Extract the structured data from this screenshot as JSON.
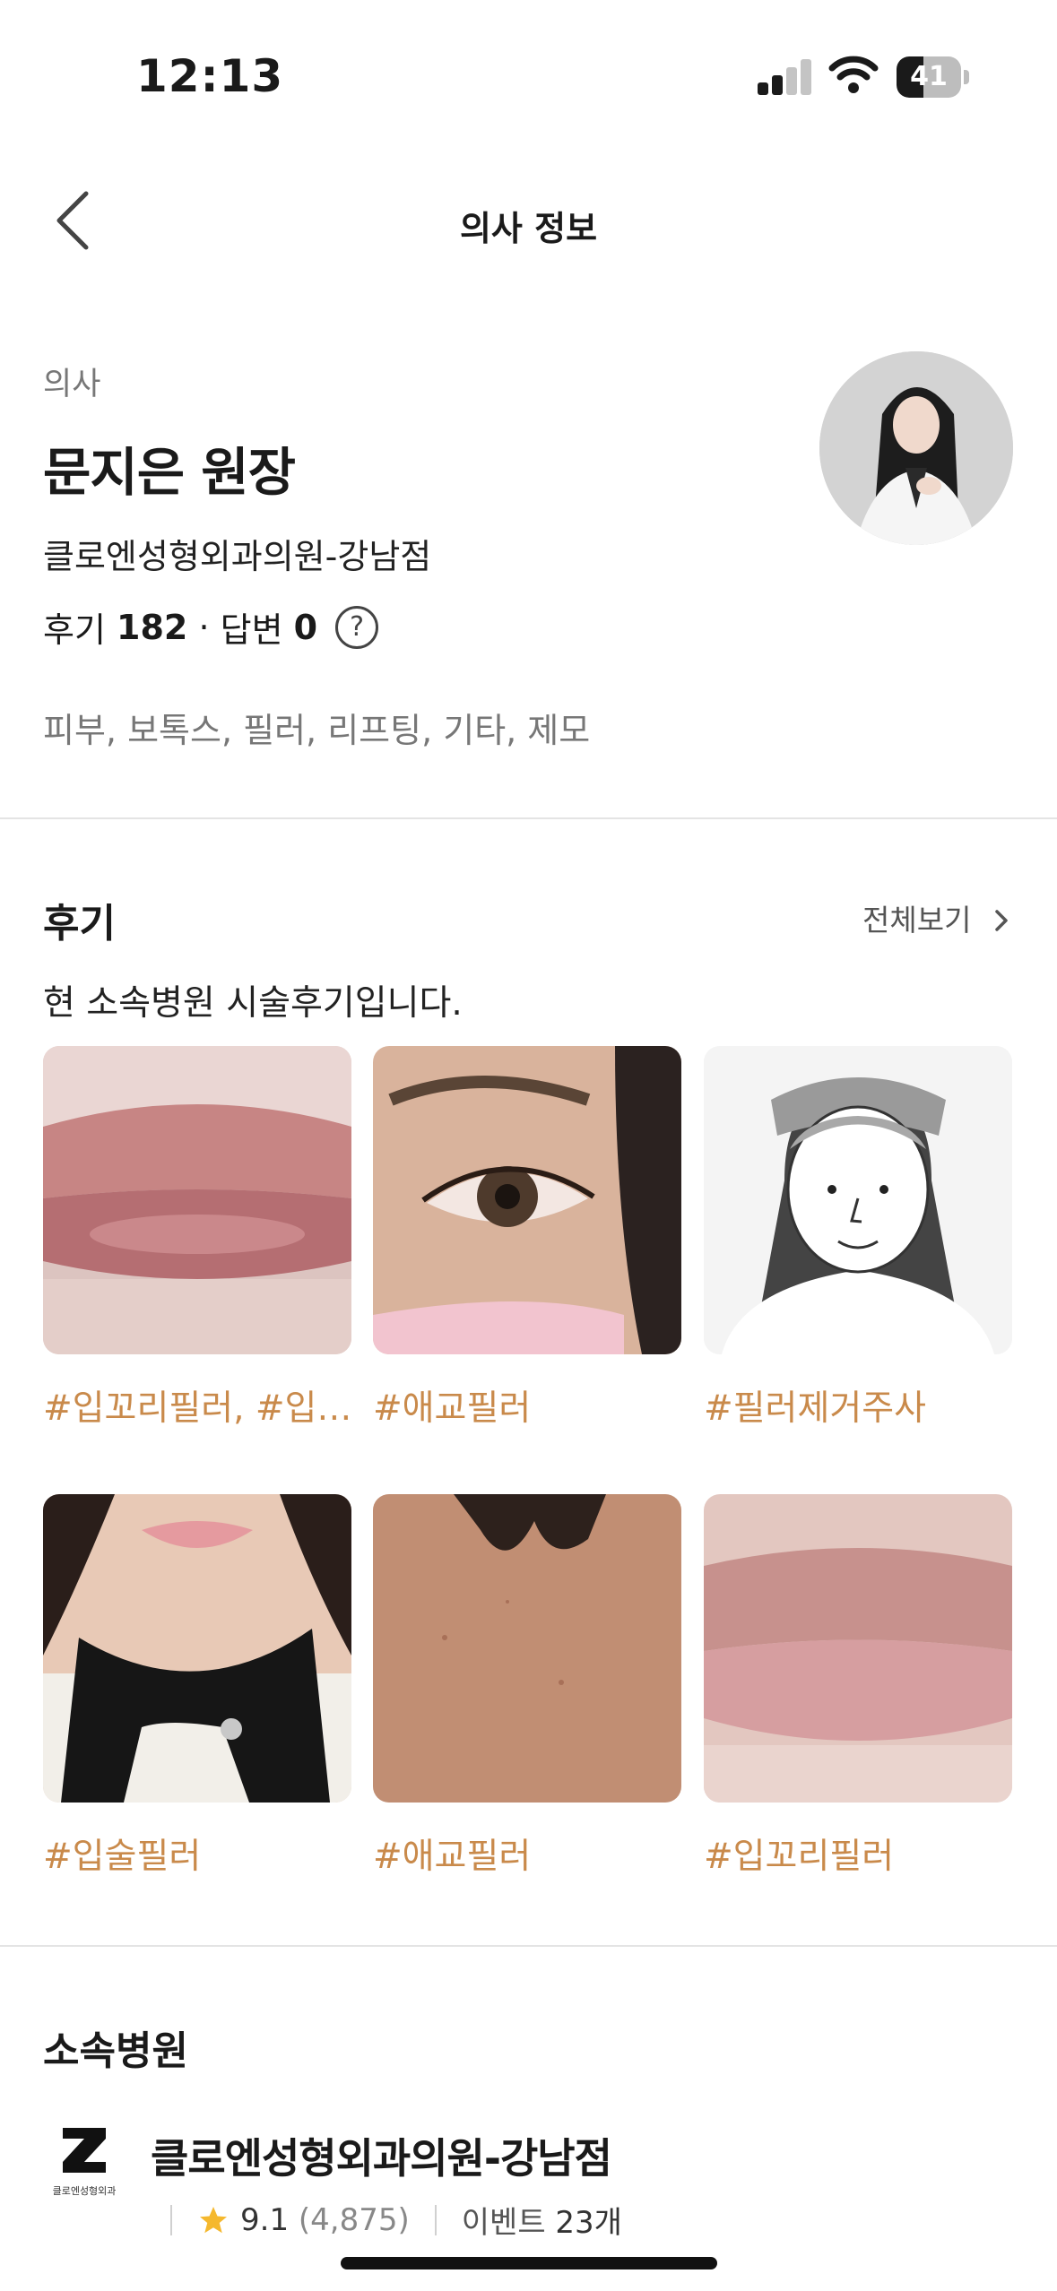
{
  "status_bar": {
    "time": "12:13",
    "battery": "41",
    "battery_level": 0.41
  },
  "nav": {
    "title": "의사 정보"
  },
  "doctor": {
    "role": "의사",
    "name": "문지은 원장",
    "clinic": "클로엔성형외과의원-강남점",
    "reviews_label": "후기",
    "reviews_count": "182",
    "dot": "·",
    "answers_label": "답변",
    "answers_count": "0",
    "help_symbol": "?",
    "specialties": "피부, 보톡스, 필러, 리프팅, 기타, 제모"
  },
  "reviews": {
    "title": "후기",
    "view_all": "전체보기",
    "subtitle": "현 소속병원 시술후기입니다.",
    "items": [
      {
        "tag": "#입꼬리필러, #입…"
      },
      {
        "tag": "#애교필러"
      },
      {
        "tag": "#필러제거주사"
      },
      {
        "tag": "#입술필러"
      },
      {
        "tag": "#애교필러"
      },
      {
        "tag": "#입꼬리필러"
      }
    ]
  },
  "hospital": {
    "section_title": "소속병원",
    "name": "클로엔성형외과의원-강남점",
    "logo_text": "클로엔성형외과",
    "rating": "9.1",
    "rating_count": "(4,875)",
    "events_label": "이벤트",
    "events_count": "23개"
  },
  "colors": {
    "accent_tag": "#c98a4b",
    "star": "#f5b82e",
    "divider": "#e4e4e4"
  }
}
